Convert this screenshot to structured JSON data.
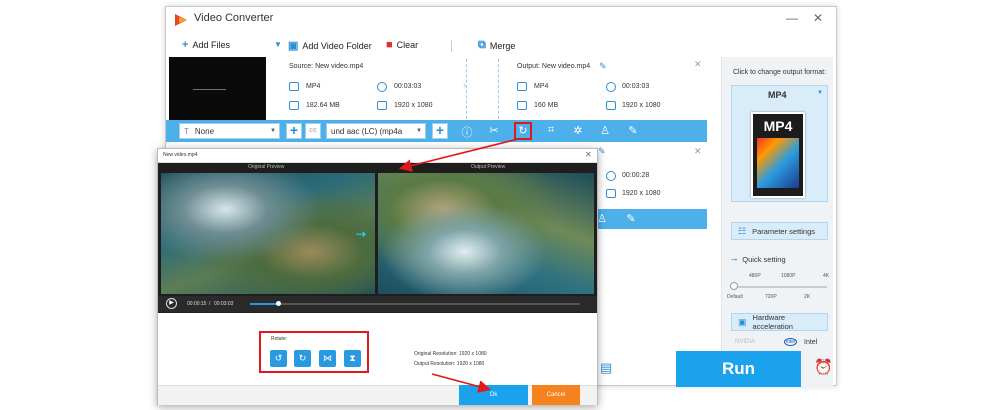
{
  "app": {
    "title": "Video Converter"
  },
  "toolbar": {
    "add_files": "Add Files",
    "add_folder": "Add Video Folder",
    "clear": "Clear",
    "merge": "Merge"
  },
  "file1": {
    "source": "Source: New video.mp4",
    "output": "Output: New video.mp4",
    "src_format": "MP4",
    "src_duration": "00:03:03",
    "src_size": "182.64 MB",
    "src_resolution": "1920 x 1080",
    "out_format": "MP4",
    "out_duration": "00:03:03",
    "out_size": "160 MB",
    "out_resolution": "1920 x 1080"
  },
  "file2": {
    "duration": "00:00:28",
    "resolution": "1920 x 1080"
  },
  "edit_toolbar": {
    "subtitle_value": "None",
    "audio_value": "und aac (LC) (mp4a"
  },
  "right_panel": {
    "click_hint": "Click to change output format:",
    "format": "MP4",
    "tile_label": "MP4",
    "param_settings": "Parameter settings",
    "quick_setting": "Quick setting",
    "quality_top": [
      "480P",
      "1080P",
      "4K"
    ],
    "quality_bottom": [
      "Default",
      "720P",
      "2K"
    ],
    "hw_accel": "Hardware acceleration",
    "gpu1": "NVIDIA",
    "gpu2": "Intel"
  },
  "run_label": "Run",
  "dialog": {
    "title": "New video.mp4",
    "original_preview": "Original Preview",
    "output_preview": "Output Preview",
    "time_current": "00:00:15",
    "time_sep": "/",
    "time_total": "00:03:03",
    "rotate_label": "Rotate:",
    "orig_res": "Original Resolution:  1920 x 1080",
    "out_res": "Output Resolution:  1920 x 1080",
    "ok": "Ok",
    "cancel": "Cancel"
  },
  "colors": {
    "accent": "#1aa3ec",
    "highlight": "#e01818",
    "cancel": "#f5811f",
    "toolbar_blue": "#4db0ea"
  }
}
